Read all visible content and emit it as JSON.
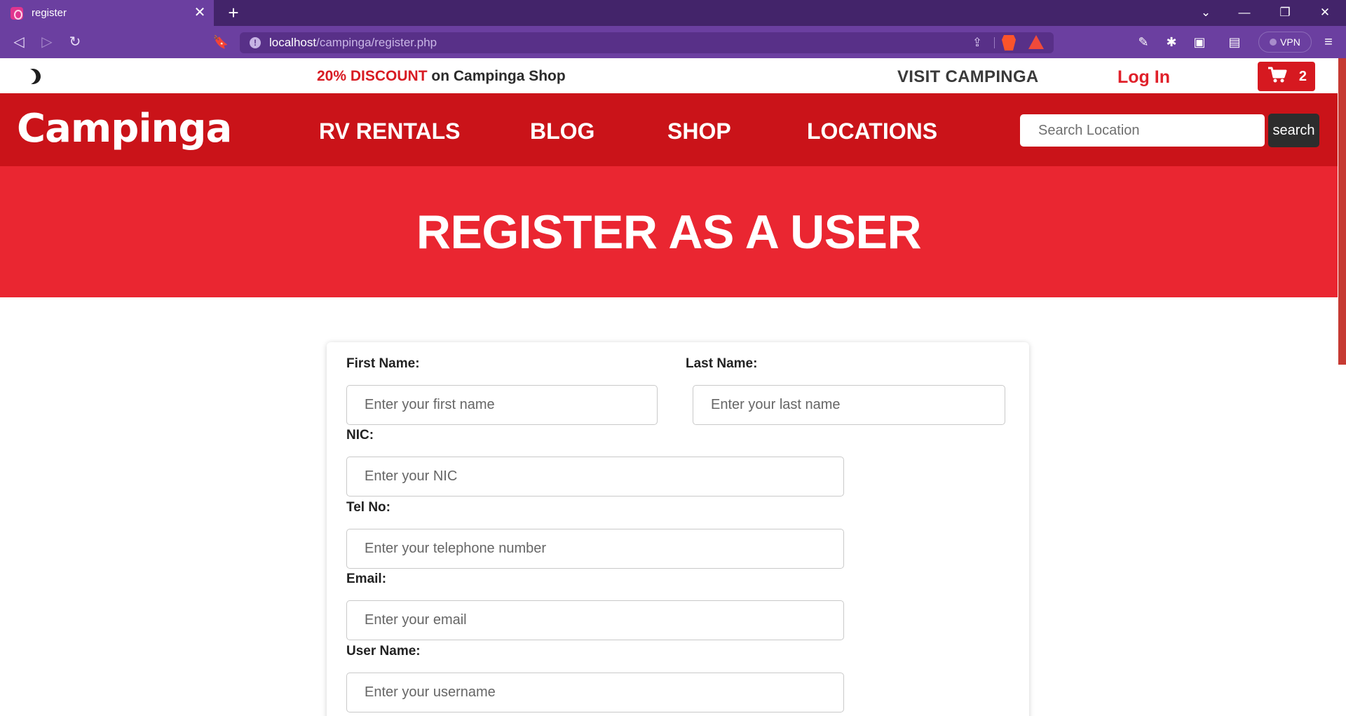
{
  "browser": {
    "tab": {
      "title": "register",
      "close": "✕"
    },
    "new_tab": "+",
    "window_controls": {
      "tab_list": "⌄",
      "minimize": "—",
      "restore": "❐",
      "close": "✕"
    },
    "nav": {
      "back": "◁",
      "forward": "▷",
      "reload": "↻"
    },
    "bookmark": "🔖",
    "url": {
      "host": "localhost",
      "path": "/campinga/register.php"
    },
    "vpn_label": "VPN"
  },
  "site": {
    "promo": {
      "accent": "20% DISCOUNT",
      "rest": " on Campinga Shop"
    },
    "visit_label": "VISIT CAMPINGA",
    "login_label": "Log In",
    "cart": {
      "count": "2",
      "icon": "🛒"
    },
    "logo": "Campinga",
    "nav": {
      "rv_rentals": "RV RENTALS",
      "blog": "BLOG",
      "shop": "SHOP",
      "locations": "LOCATIONS"
    },
    "search": {
      "placeholder": "Search Location",
      "button": "search"
    },
    "colors": {
      "brand_red": "#ca1319",
      "hero_red": "#ea2631",
      "accent_red": "#d81b23"
    }
  },
  "hero": {
    "title": "REGISTER AS A USER"
  },
  "form": {
    "first_name": {
      "label": "First Name:",
      "placeholder": "Enter your first name"
    },
    "last_name": {
      "label": "Last Name:",
      "placeholder": "Enter your last name"
    },
    "nic": {
      "label": "NIC:",
      "placeholder": "Enter your NIC"
    },
    "tel": {
      "label": "Tel No:",
      "placeholder": "Enter your telephone number"
    },
    "email": {
      "label": "Email:",
      "placeholder": "Enter your email"
    },
    "username": {
      "label": "User Name:",
      "placeholder": "Enter your username"
    }
  }
}
